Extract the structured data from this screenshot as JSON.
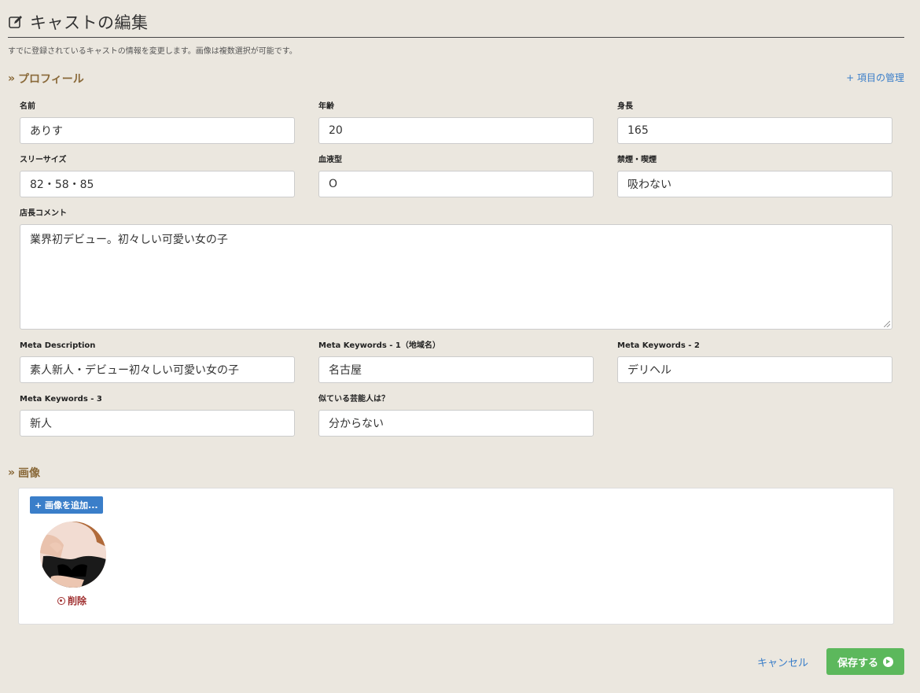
{
  "header": {
    "title": "キャストの編集",
    "subtitle": "すでに登録されているキャストの情報を変更します。画像は複数選択が可能です。"
  },
  "profile": {
    "section_label": "プロフィール",
    "manage_link": "+ 項目の管理",
    "fields": {
      "name": {
        "label": "名前",
        "value": "ありす"
      },
      "age": {
        "label": "年齢",
        "value": "20"
      },
      "height": {
        "label": "身長",
        "value": "165"
      },
      "three_size": {
        "label": "スリーサイズ",
        "value": "82・58・85"
      },
      "blood_type": {
        "label": "血液型",
        "value": "O"
      },
      "smoking": {
        "label": "禁煙・喫煙",
        "value": "吸わない"
      },
      "manager_comment": {
        "label": "店長コメント",
        "value": "業界初デビュー。初々しい可愛い女の子"
      },
      "meta_description": {
        "label": "Meta Description",
        "value": "素人新人・デビュー初々しい可愛い女の子"
      },
      "meta_keywords_1": {
        "label": "Meta Keywords - 1（地域名）",
        "value": "名古屋"
      },
      "meta_keywords_2": {
        "label": "Meta Keywords - 2",
        "value": "デリヘル"
      },
      "meta_keywords_3": {
        "label": "Meta Keywords - 3",
        "value": "新人"
      },
      "lookalike": {
        "label": "似ている芸能人は？",
        "value": "分からない"
      }
    }
  },
  "images": {
    "section_label": "画像",
    "add_button": "+ 画像を追加...",
    "delete_label": "削除"
  },
  "footer": {
    "cancel_label": "キャンセル",
    "save_label": "保存する"
  },
  "colors": {
    "background": "#ebe7df",
    "section_heading": "#8a6a3a",
    "link": "#3a7ec9",
    "save": "#5cb85c",
    "delete": "#a03030"
  }
}
